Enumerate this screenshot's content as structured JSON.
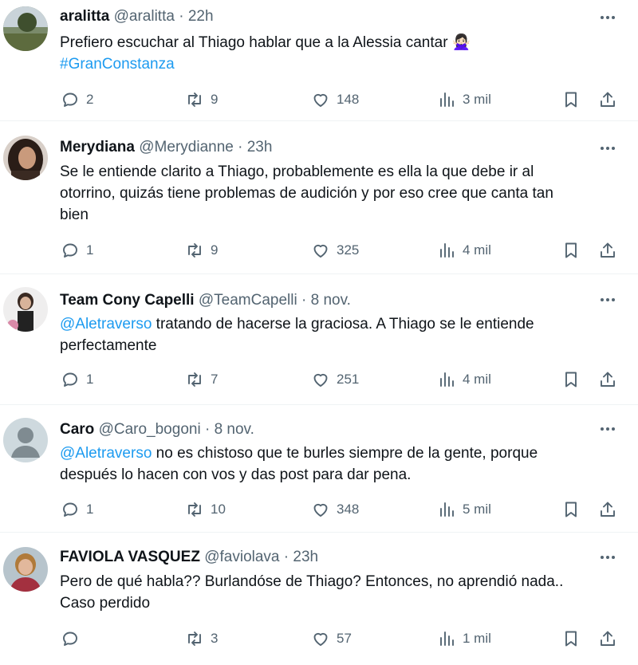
{
  "tweets": [
    {
      "name": "aralitta",
      "handle": "@aralitta",
      "sep": "·",
      "time": "22h",
      "text": "Prefiero escuchar al Thiago hablar que a la Alessia cantar 🙅🏻‍♀️",
      "hashtag": "#GranConstanza",
      "replies": "2",
      "retweets": "9",
      "likes": "148",
      "views": "3 mil"
    },
    {
      "name": "Merydiana",
      "handle": "@Merydianne",
      "sep": "·",
      "time": "23h",
      "text_lines": [
        "Se le entiende clarito a Thiago, probablemente es ella la que debe ir al",
        "otorrino, quizás tiene problemas de audición y por eso cree que canta tan",
        "bien"
      ],
      "replies": "1",
      "retweets": "9",
      "likes": "325",
      "views": "4 mil"
    },
    {
      "name": "Team Cony Capelli",
      "handle": "@TeamCapelli",
      "sep": "·",
      "time": "8 nov.",
      "mention": "@Aletraverso",
      "text_line1": " tratando de hacerse la graciosa. A Thiago se le entiende",
      "text_line2": "perfectamente",
      "replies": "1",
      "retweets": "7",
      "likes": "251",
      "views": "4 mil"
    },
    {
      "name": "Caro",
      "handle": "@Caro_bogoni",
      "sep": "·",
      "time": "8 nov.",
      "mention": "@Aletraverso",
      "text_line1": " no es chistoso que te burles siempre de la gente, porque",
      "text_line2": "después lo hacen con vos y das post para dar pena.",
      "replies": "1",
      "retweets": "10",
      "likes": "348",
      "views": "5 mil"
    },
    {
      "name": "FAVIOLA VASQUEZ",
      "handle": "@faviolava",
      "sep": "·",
      "time": "23h",
      "text_lines": [
        "Pero de qué habla?? Burlandóse de Thiago? Entonces, no aprendió nada..",
        "Caso perdido"
      ],
      "retweets": "3",
      "likes": "57",
      "views": "1 mil"
    }
  ],
  "colors": {
    "link": "#1d9bf0",
    "muted": "#536471",
    "text": "#0f1419"
  },
  "icons": [
    "reply-icon",
    "retweet-icon",
    "like-icon",
    "views-icon",
    "bookmark-icon",
    "share-icon",
    "more-icon"
  ]
}
